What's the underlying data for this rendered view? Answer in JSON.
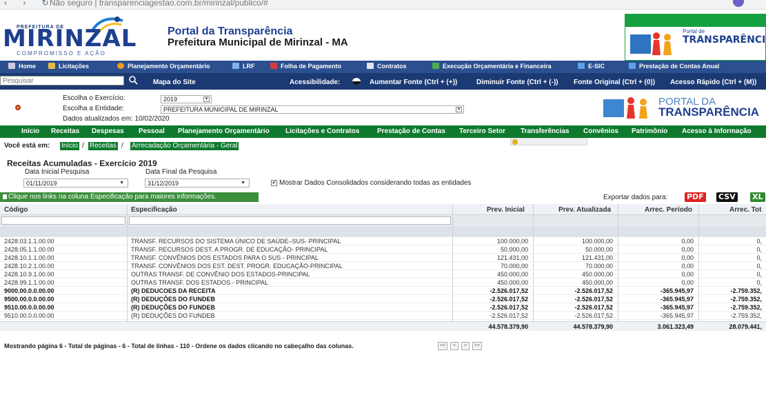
{
  "browser": {
    "url": "Não seguro | transparenciagestao.com.br/mirinzal/publico/#"
  },
  "header": {
    "logo_top": "PREFEITURA DE",
    "logo_name": "MIRINZAL",
    "logo_tagline": "COMPROMISSO E AÇÃO",
    "title": "Portal da Transparência",
    "subtitle": "Prefeitura Municipal de Mirinzal - MA",
    "right_logo_small": "Portal de",
    "right_logo_big": "TRANSPARÊNCIA"
  },
  "topnav": {
    "items": [
      "Home",
      "Licitações",
      "Planejamento Orçamentário",
      "LRF",
      "Folha de Pagamento",
      "Contratos",
      "Execução Orçamentária e Financeira",
      "E-SIC",
      "Prestação de Contas Anual"
    ]
  },
  "searchbar": {
    "placeholder": "Pesquisar",
    "sitemap": "Mapa do Site",
    "accessibility": "Acessibilidade:",
    "font_up": "Aumentar Fonte (Ctrl + (+))",
    "font_down": "Diminuir Fonte (Ctrl + (-))",
    "font_reset": "Fonte Original (Ctrl + (0))",
    "quick_access": "Acesso Rápido (Ctrl + (M))"
  },
  "filters": {
    "exercise_label": "Escolha o Exercício:",
    "exercise_value": "2019",
    "entity_label": "Escolha a Entidade:",
    "entity_value": "PREFEITURA MUNICIPAL DE MIRINZAL",
    "updated": "Dados atualizados em: 10/02/2020",
    "logo_line1": "PORTAL DA",
    "logo_line2": "TRANSPARÊNCIA"
  },
  "greennav": {
    "items": [
      "Início",
      "Receitas",
      "Despesas",
      "Pessoal",
      "Planejamento Orçamentário",
      "Licitações e Contratos",
      "Prestação de Contas",
      "Terceiro Setor",
      "Transferências",
      "Convênios",
      "Patrimônio",
      "Acesso à Informação"
    ]
  },
  "breadcrumb": {
    "label": "Você está em:",
    "items": [
      "Início",
      "Receitas",
      "Arrecadação Orçamentária - Geral"
    ]
  },
  "form": {
    "title": "Receitas Acumuladas - Exercício 2019",
    "start_label": "Data Inicial Pesquisa",
    "start_value": "01/11/2019",
    "end_label": "Data Final da Pesquisa",
    "end_value": "31/12/2019",
    "consolidated_label": "Mostrar Dados Consolidados considerando todas as entidades",
    "consolidated_checked": true
  },
  "info": {
    "text": "Clique nos links na coluna Especificação para maiores informações.",
    "export_label": "Exportar dados para:",
    "export_pdf": "PDF",
    "export_csv": "CSV",
    "export_xls": "XL"
  },
  "table": {
    "columns": [
      "Código",
      "Especificação",
      "Prev. Inicial",
      "Prev. Atualizada",
      "Arrec. Período",
      "Arrec. Tot"
    ],
    "rows": [
      {
        "bold": false,
        "cells": [
          "2428.03.1.1.00.00",
          "TRANSF. RECURSOS DO SISTEMA ÚNICO DE SAÚDE–SUS- PRINCIPAL",
          "100.000,00",
          "100.000,00",
          "0,00",
          "0,"
        ]
      },
      {
        "bold": false,
        "cells": [
          "2428.05.1.1.00.00",
          "TRANSF. RECURSOS DEST. A PROGR. DE EDUCAÇÃO- PRINCIPAL",
          "50.000,00",
          "50.000,00",
          "0,00",
          "0,"
        ]
      },
      {
        "bold": false,
        "cells": [
          "2428.10.1.1.00.00",
          "TRANSF. CONVÊNIOS DOS ESTADOS PARA O SUS - PRINCIPAL",
          "121.431,00",
          "121.431,00",
          "0,00",
          "0,"
        ]
      },
      {
        "bold": false,
        "cells": [
          "2428.10.2.1.00.00",
          "TRANSF. CONVÊNIOS DOS EST. DEST. PROGR. EDUCAÇÃO-PRINCIPAL",
          "70.000,00",
          "70.000,00",
          "0,00",
          "0,"
        ]
      },
      {
        "bold": false,
        "cells": [
          "2428.10.9.1.00.00",
          "OUTRAS TRANSF. DE CONVÊNIO DOS ESTADOS-PRINCIPAL",
          "450.000,00",
          "450.000,00",
          "0,00",
          "0,"
        ]
      },
      {
        "bold": false,
        "cells": [
          "2428.99.1.1.00.00",
          "OUTRAS TRANSF. DOS ESTADOS - PRINCIPAL",
          "450.000,00",
          "450.000,00",
          "0,00",
          "0,"
        ]
      },
      {
        "bold": true,
        "cells": [
          "9000.00.0.0.00.00",
          "(R) DEDUCOES DA RECEITA",
          "-2.526.017,52",
          "-2.526.017,52",
          "-365.945,97",
          "-2.759.352,"
        ]
      },
      {
        "bold": true,
        "cells": [
          "9500.00.0.0.00.00",
          "(R) DEDUÇÕES DO FUNDEB",
          "-2.526.017,52",
          "-2.526.017,52",
          "-365.945,97",
          "-2.759.352,"
        ]
      },
      {
        "bold": true,
        "cells": [
          "9510.00.0.0.00.00",
          "(R) DEDUÇÕES DO FUNDEB",
          "-2.526.017,52",
          "-2.526.017,52",
          "-365.945,97",
          "-2.759.352,"
        ]
      },
      {
        "bold": false,
        "cells": [
          "9510.00.0.0.00.00",
          "(R) DEDUÇÕES DO FUNDEB",
          "-2.526.017,52",
          "-2.526.017,52",
          "-365.945,97",
          "-2.759.352,"
        ]
      }
    ],
    "totals": [
      "44.578.379,90",
      "44.578.379,90",
      "3.061.323,49",
      "28.079.441,"
    ]
  },
  "pager": {
    "text": "Mostrando página 6 - Total de páginas - 6 - Total de linhas - 110 - Ordene os dados clicando no cabeçalho das colunas.",
    "first": "<<",
    "prev": "<",
    "next": ">",
    "last": ">>"
  },
  "colors": {
    "nav_blue": "#2b4f8f",
    "dark_blue": "#1b3a73",
    "green": "#0f7a2e",
    "pdf_red": "#e02020",
    "csv_black": "#111111",
    "xls_green": "#2e8b2e"
  }
}
